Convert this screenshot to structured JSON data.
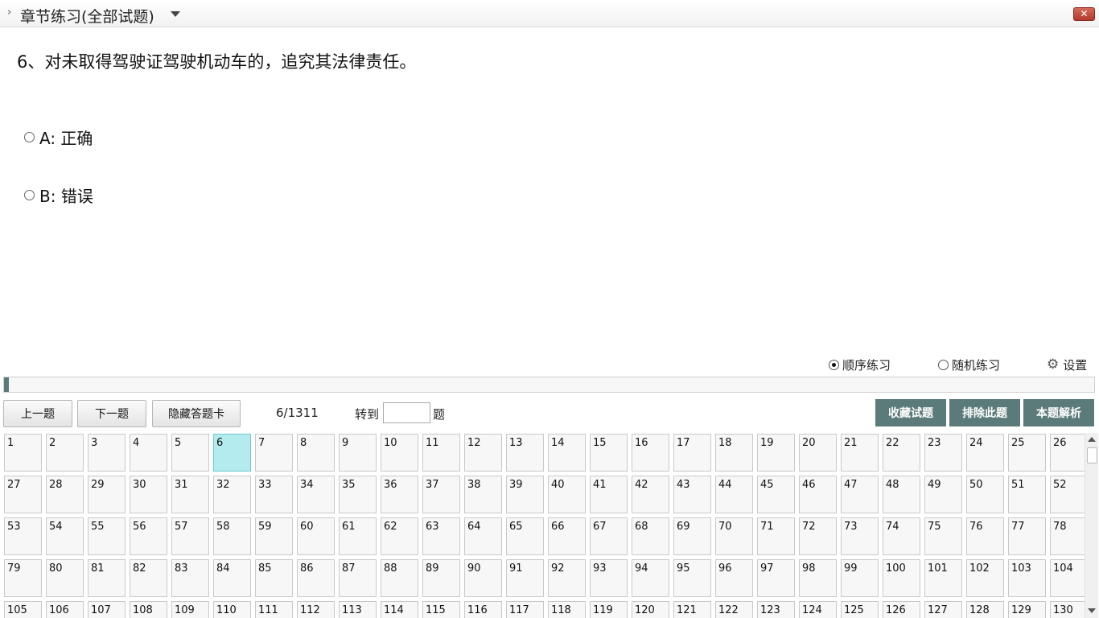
{
  "window": {
    "title": "章节练习(全部试题)",
    "close_label": "✕"
  },
  "question": {
    "text": "6、对未取得驾驶证驾驶机动车的，追究其法律责任。",
    "options": [
      {
        "label": "A: 正确"
      },
      {
        "label": "B: 错误"
      }
    ]
  },
  "modes": {
    "sequential": "顺序练习",
    "random": "随机练习",
    "selected": "sequential",
    "settings": "设置"
  },
  "progress": {
    "current": 6,
    "total": 1311
  },
  "toolbar": {
    "prev": "上一题",
    "next": "下一题",
    "hide_card": "隐藏答题卡",
    "counter": "6/1311",
    "goto_label": "转到",
    "goto_value": "",
    "goto_unit": "题",
    "favorite": "收藏试题",
    "exclude": "排除此题",
    "explanation": "本题解析"
  },
  "answer_card": {
    "columns": 26,
    "visible_count": 130,
    "current": 6
  },
  "colors": {
    "accent": "#5b7b7a",
    "current_cell": "#b3ebee"
  }
}
